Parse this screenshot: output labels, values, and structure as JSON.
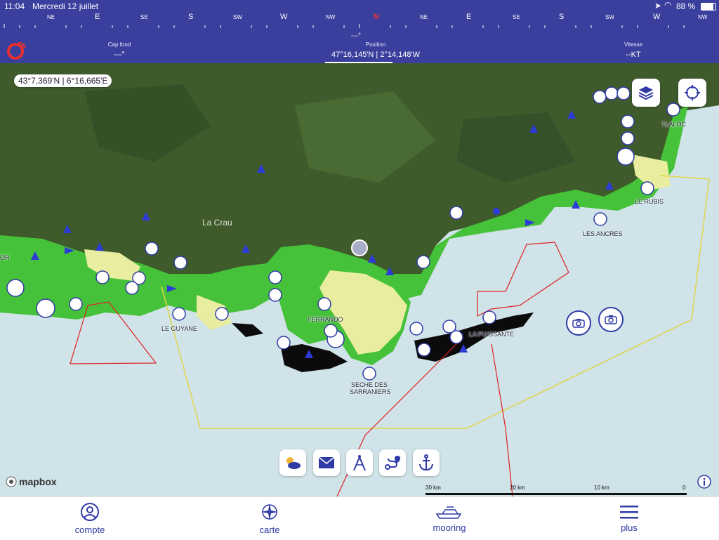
{
  "status_bar": {
    "time": "11:04",
    "date": "Mercredi 12 juillet",
    "battery": "88 %"
  },
  "compass": {
    "ticks": [
      "NE",
      "E",
      "SE",
      "S",
      "SW",
      "W",
      "NW",
      "N",
      "NE",
      "E",
      "SE",
      "S",
      "SW",
      "W",
      "NW"
    ],
    "heading_marker": "N",
    "heading_value": "---°"
  },
  "nav_info": {
    "cap_fond_label": "Cap fond",
    "cap_fond_value": "---°",
    "position_label": "Position",
    "position_value": "47°16,145'N | 2°14,148'W",
    "vitesse_label": "Vitesse",
    "vitesse_value": "--KT"
  },
  "map": {
    "cursor_coordinates": "43°7,369'N | 6°16,665'E",
    "place_labels": {
      "la_crau": "La Crau",
      "le_guyane": "LE GUYANE",
      "ferrando": "FERRANDO",
      "seche_1": "SECHE DES",
      "seche_2": "SARRANIERS",
      "la_puissante": "LA PUISSANTE",
      "les_ancres": "LES ANCRES",
      "le_rubis": "LE RUBIS",
      "tlaloc": "TLALOC",
      "edge_or": "OR"
    },
    "attribution": "mapbox",
    "scale": [
      "30 km",
      "20 km",
      "10 km",
      "0"
    ],
    "colors": {
      "land": "#3f5b2c",
      "shallow": "#46c23a",
      "sand": "#e8eda0",
      "rock": "#0b0b0b",
      "sea": "#cfe3e8",
      "accent": "#2f3aa6"
    },
    "icons": {
      "layers": "layers-icon",
      "locate": "crosshair-icon",
      "weather": "weather-icon",
      "messages": "envelope-icon",
      "measure": "compass-divider-icon",
      "route": "route-icon",
      "anchor": "anchor-icon",
      "info": "info-icon"
    }
  },
  "tabbar": {
    "items": [
      {
        "label": "compte",
        "icon": "user-icon"
      },
      {
        "label": "carte",
        "icon": "compass-rose-icon"
      },
      {
        "label": "mooring",
        "icon": "boat-icon"
      },
      {
        "label": "plus",
        "icon": "menu-icon"
      }
    ]
  }
}
